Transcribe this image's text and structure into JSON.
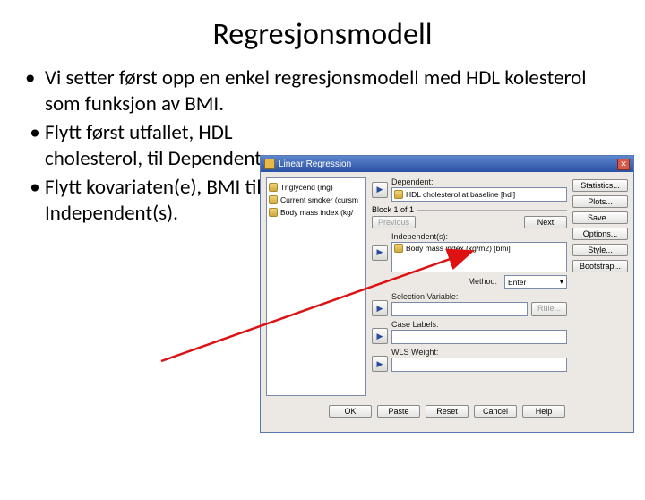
{
  "title": "Regresjonsmodell",
  "bullets": [
    "Vi setter først opp en enkel regresjonsmodell med HDL kolesterol som funksjon av BMI.",
    "Flytt først utfallet, HDL cholesterol, til Dependent",
    "Flytt kovariaten(e), BMI til Independent(s)."
  ],
  "dialog": {
    "title": "Linear Regression",
    "close": "✕",
    "vars": [
      "Triglycend (mg)",
      "Current smoker (cursm",
      "Body mass index (kg/"
    ],
    "dep_label": "Dependent:",
    "dep_value": "HDL cholesterol at baseline [hdl]",
    "block_label": "Block 1 of 1",
    "prev": "Previous",
    "next": "Next",
    "indep_label": "Independent(s):",
    "indep_value": "Body mass index (kg/m2) [bmi]",
    "method_label": "Method:",
    "method_value": "Enter",
    "selvar_label": "Selection Variable:",
    "rule_btn": "Rule...",
    "case_label": "Case Labels:",
    "wls_label": "WLS Weight:",
    "right_buttons": [
      "Statistics...",
      "Plots...",
      "Save...",
      "Options...",
      "Style...",
      "Bootstrap..."
    ],
    "footer": [
      "OK",
      "Paste",
      "Reset",
      "Cancel",
      "Help"
    ]
  }
}
